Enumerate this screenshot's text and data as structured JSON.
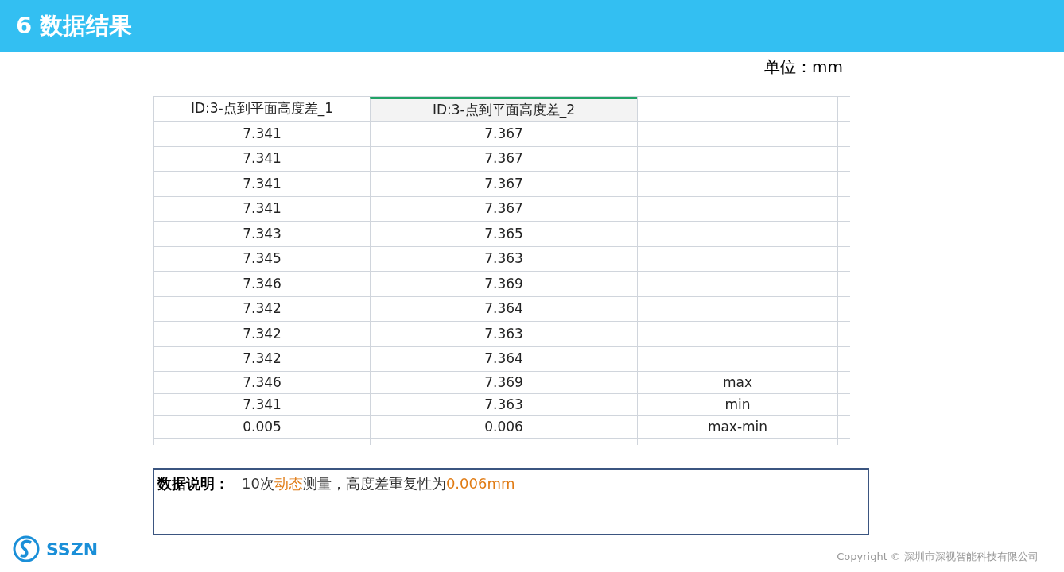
{
  "header": {
    "title": "6 数据结果"
  },
  "unit": "单位：mm",
  "table": {
    "columns": [
      {
        "label": "ID:3-点到平面高度差_1",
        "selected": false
      },
      {
        "label": "ID:3-点到平面高度差_2",
        "selected": true
      },
      {
        "selected": false
      }
    ],
    "rows": [
      {
        "cells": [
          "7.341",
          "7.367"
        ]
      },
      {
        "cells": [
          "7.341",
          "7.367"
        ]
      },
      {
        "cells": [
          "7.341",
          "7.367"
        ]
      },
      {
        "cells": [
          "7.341",
          "7.367"
        ]
      },
      {
        "cells": [
          "7.343",
          "7.365"
        ]
      },
      {
        "cells": [
          "7.345",
          "7.363"
        ]
      },
      {
        "cells": [
          "7.346",
          "7.369"
        ]
      },
      {
        "cells": [
          "7.342",
          "7.364"
        ]
      },
      {
        "cells": [
          "7.342",
          "7.363"
        ]
      },
      {
        "cells": [
          "7.342",
          "7.364"
        ]
      },
      {
        "cells": [
          "7.346",
          "7.369",
          "max"
        ],
        "kind": "summary"
      },
      {
        "cells": [
          "7.341",
          "7.363",
          "min"
        ],
        "kind": "summary"
      },
      {
        "cells": [
          "0.005",
          "0.006",
          "max-min"
        ],
        "kind": "summary"
      }
    ]
  },
  "note": {
    "label": "数据说明：",
    "segments": [
      {
        "text": "10次",
        "highlighted": false
      },
      {
        "text": "动态",
        "highlighted": true
      },
      {
        "text": "测量，高度差重复性为",
        "highlighted": false
      },
      {
        "text": "0.006mm",
        "highlighted": true
      }
    ]
  },
  "logo": {
    "text": "SSZN"
  },
  "footer": "Copyright © 深圳市深视智能科技有限公司"
}
